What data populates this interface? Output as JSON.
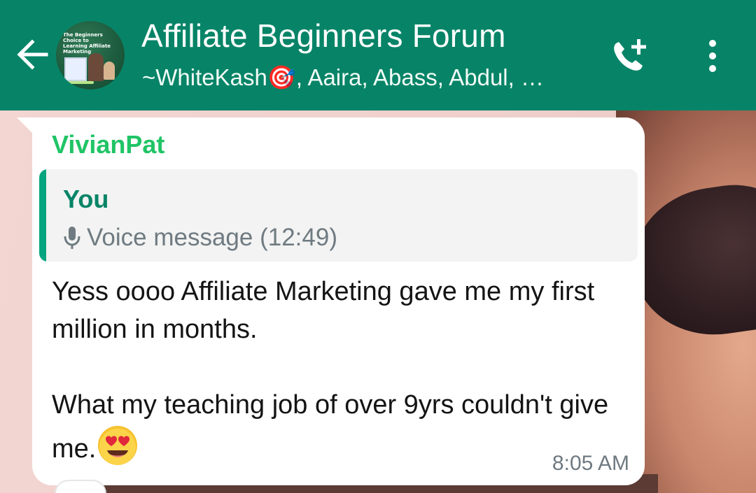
{
  "header": {
    "title": "Affiliate Beginners Forum",
    "subtitle": "~WhiteKash🎯, Aaira, Abass, Abdul, …",
    "avatar_text": "The Beginners Choice to Learning Affiliate Marketing",
    "background_color": "#078467"
  },
  "message": {
    "sender": "VivianPat",
    "sender_color": "#20c466",
    "quoted": {
      "author": "You",
      "content": "Voice message (12:49)",
      "icon": "mic-icon"
    },
    "body": "Yess oooo Affiliate Marketing gave me my first million in months.\n\nWhat my teaching job of over 9yrs couldn't give me.",
    "emoji": "heart-eyes-emoji",
    "time": "8:05 AM"
  },
  "icons": {
    "back": "back-arrow-icon",
    "call": "add-call-icon",
    "menu": "more-vertical-icon"
  }
}
